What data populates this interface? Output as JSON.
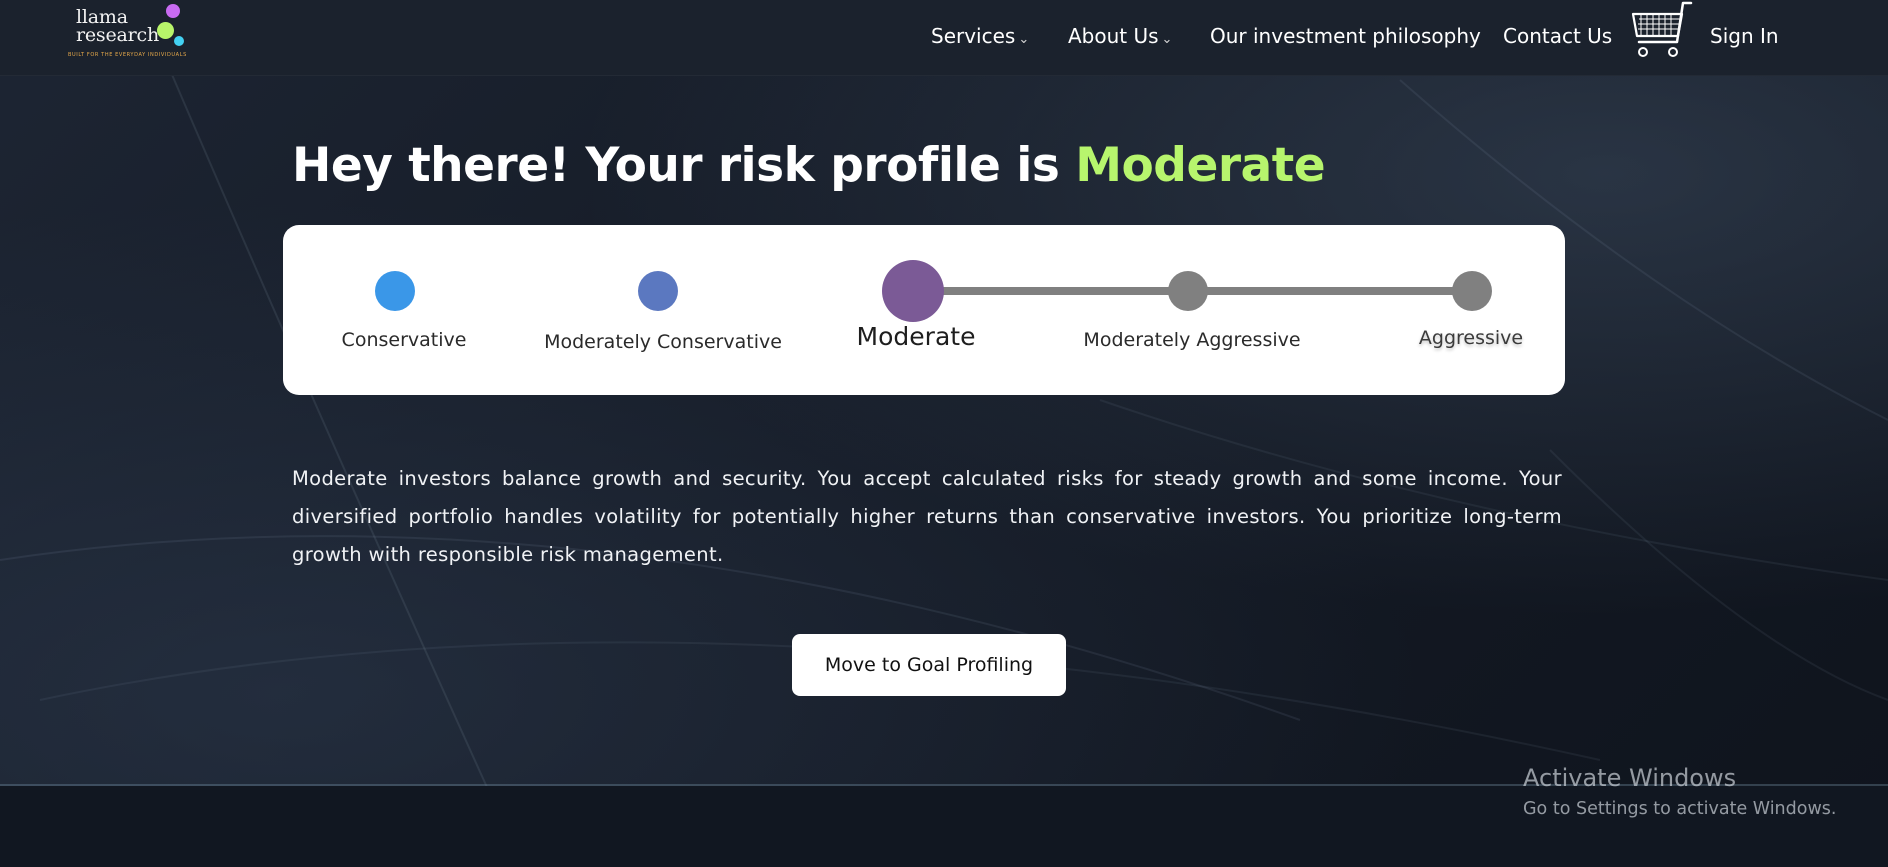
{
  "brand": {
    "logo_line1": "llama",
    "logo_line2": "research",
    "tagline": "BUILT FOR THE EVERYDAY INDIVIDUALS",
    "colors": {
      "purple": "#c86bf1",
      "green": "#b8f56a",
      "cyan": "#43d1f2",
      "tagline": "#e7a94a"
    }
  },
  "nav": {
    "services": "Services",
    "about": "About Us",
    "philosophy": "Our investment philosophy",
    "contact": "Contact Us",
    "cart_icon": "shopping-cart-icon",
    "sign_in": "Sign In",
    "caret": "⌄"
  },
  "headline": {
    "prefix": "Hey there! Your risk profile is",
    "profile": "Moderate",
    "accent_color": "#b7f56d"
  },
  "risk_scale": {
    "selected_index": 2,
    "levels": [
      {
        "label": "Conservative",
        "color": "#3a97e8"
      },
      {
        "label": "Moderately Conservative",
        "color": "#5b78c0"
      },
      {
        "label": "Moderate",
        "color": "#7b5a96"
      },
      {
        "label": "Moderately Aggressive",
        "color": "#808080"
      },
      {
        "label": "Aggressive",
        "color": "#808080"
      }
    ]
  },
  "description": "Moderate investors balance growth and security. You accept calculated risks for steady growth and some income. Your diversified portfolio handles volatility for potentially higher returns than conservative investors. You prioritize long-term growth with responsible risk management.",
  "cta": {
    "label": "Move to Goal Profiling"
  },
  "windows_watermark": {
    "title": "Activate Windows",
    "subtitle": "Go to Settings to activate Windows."
  }
}
